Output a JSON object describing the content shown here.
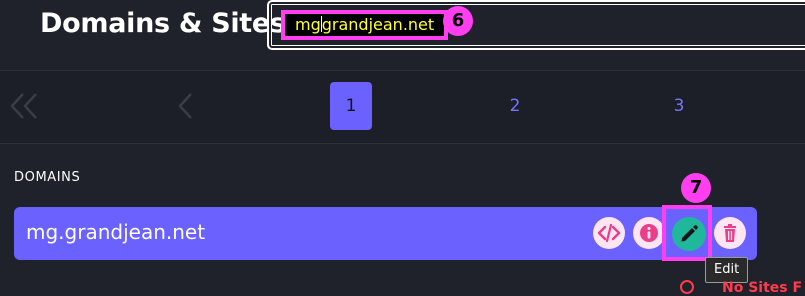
{
  "header": {
    "title": "Domains & Sites",
    "search": {
      "value_before_caret": "mg",
      "value_after_caret": "grandjean.net"
    },
    "marker_search": "6"
  },
  "pagination": {
    "first_icon": "double-chevron-left-icon",
    "prev_icon": "chevron-left-icon",
    "pages": [
      "1",
      "2",
      "3"
    ],
    "active_page": "1"
  },
  "domains": {
    "section_label": "DOMAINS",
    "items": [
      {
        "name": "mg.grandjean.net",
        "actions": [
          "code-icon",
          "info-icon",
          "pencil-icon",
          "trash-icon"
        ]
      }
    ],
    "marker_edit": "7",
    "edit_tooltip": "Edit"
  },
  "status": {
    "no_sites": "No Sites F"
  },
  "colors": {
    "background": "#1f222b",
    "accent": "#6a61ff",
    "highlight": "#ff3ef0",
    "edit_button": "#1fb89a",
    "action_icon": "#e83e8c",
    "error": "#ff3b4e"
  }
}
